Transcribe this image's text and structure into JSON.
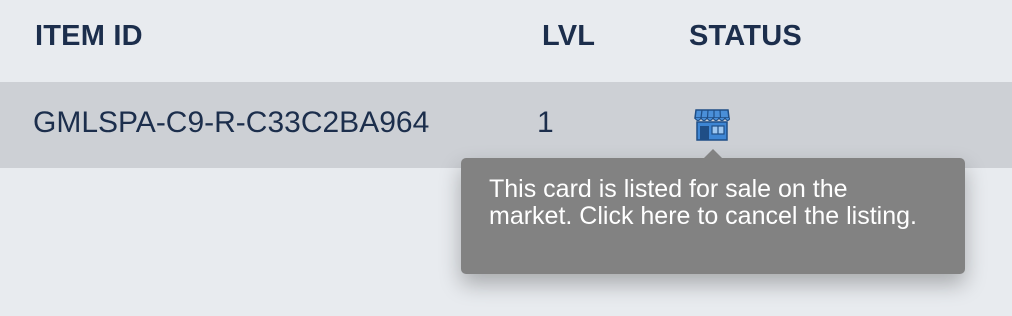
{
  "table": {
    "headers": {
      "item_id": "ITEM ID",
      "level": "LVL",
      "status": "STATUS"
    },
    "rows": [
      {
        "item_id": "GMLSPA-C9-R-C33C2BA964",
        "level": "1",
        "status_icon": "market-stall-icon"
      }
    ]
  },
  "tooltip": {
    "text": "This card is listed for sale on the market. Click here to cancel the listing."
  },
  "colors": {
    "header_text": "#1c2e4c",
    "row_background": "#cdd0d5",
    "page_background": "#e8ebef",
    "tooltip_background": "#828282",
    "icon_blue": "#3e86d4"
  }
}
